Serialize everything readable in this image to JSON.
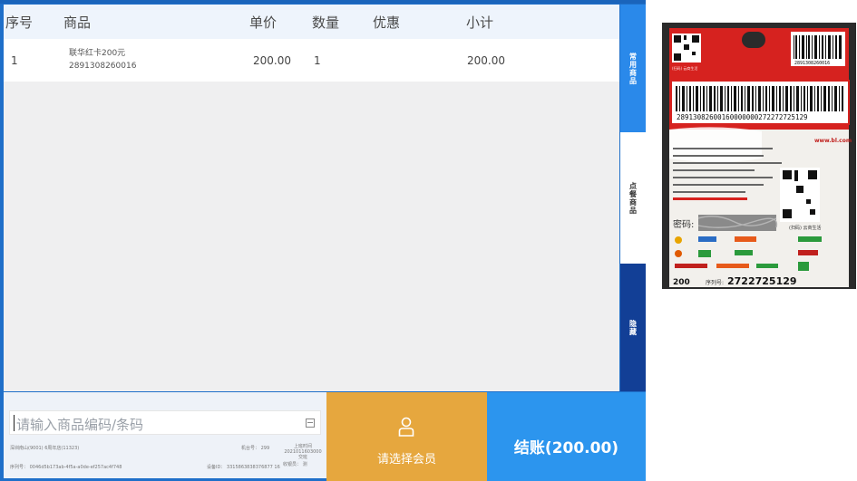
{
  "table": {
    "headers": [
      "序号",
      "商品",
      "单价",
      "数量",
      "优惠",
      "小计"
    ],
    "rows": [
      {
        "index": "1",
        "name": "联华红卡200元",
        "code": "2891308260016",
        "price": "200.00",
        "qty": "1",
        "discount": "",
        "subtotal": "200.00"
      }
    ]
  },
  "side_tabs": [
    "常用商品",
    "点餐商品",
    "隐藏"
  ],
  "search": {
    "placeholder": "请输入商品编码/条码"
  },
  "status": {
    "store": "深圳南山(9001) 6周年店(11323)",
    "terminal": "机台号：  299",
    "shift": "上班时间2021011603000  交班",
    "device": "序列号： 0046d5b173ab-4f5a-a0de-ef257ac4f748",
    "device_id": "设备ID： 3315863838376877 16",
    "cashier": "收银员： 测"
  },
  "member_button": {
    "label": "请选择会员",
    "icon": "user-icon"
  },
  "checkout_button": {
    "label": "结账(200.00)"
  },
  "card": {
    "top_barcode": "2891308260016",
    "long_barcode": "28913082600160000000272272725129",
    "website": "www.bl.com",
    "pin_label": "密码:",
    "denomination": "200",
    "serial_label": "序列号:",
    "serial": "2722725129",
    "scan_text": "(扫码)  云商生活"
  },
  "colors": {
    "accent_blue": "#2c95ee",
    "dark_blue": "#123f96",
    "orange": "#e6a73e",
    "card_red": "#d6221f"
  }
}
